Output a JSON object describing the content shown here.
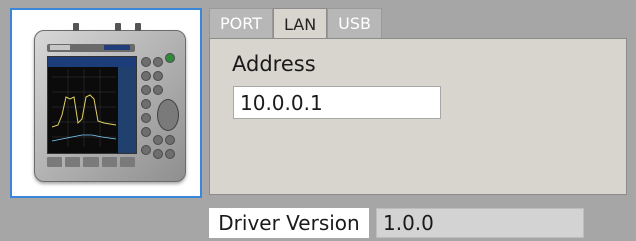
{
  "device_image": {
    "icon": "spectrum-analyzer-device-icon"
  },
  "tabs": [
    {
      "label": "PORT",
      "active": false
    },
    {
      "label": "LAN",
      "active": true
    },
    {
      "label": "USB",
      "active": false
    }
  ],
  "lan": {
    "address_label": "Address",
    "address_value": "10.0.0.1"
  },
  "driver": {
    "version_label": "Driver Version",
    "version_value": "1.0.0"
  },
  "colors": {
    "background": "#a6a6a6",
    "panel": "#d8d5ce",
    "selection_border": "#3a86d8",
    "inactive_tab": "#b7b7b7"
  }
}
